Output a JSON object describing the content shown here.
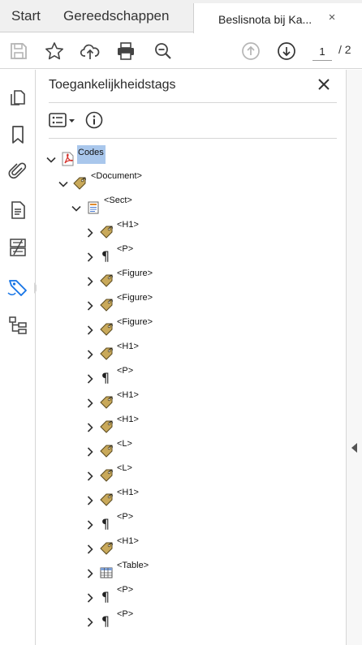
{
  "tabs": {
    "start": "Start",
    "tools": "Gereedschappen",
    "document": "Beslisnota bij Ka...",
    "close": "×"
  },
  "toolbar": {
    "icons": [
      "save-icon",
      "star-icon",
      "cloud-upload-icon",
      "print-icon",
      "zoom-out-icon",
      "page-up-icon",
      "page-down-icon"
    ],
    "page_current": "1",
    "page_total": "/ 2"
  },
  "rail": {
    "icons": [
      "pages-icon",
      "bookmark-icon",
      "attachment-icon",
      "document-icon",
      "compare-icon",
      "tags-icon",
      "content-tree-icon"
    ],
    "active": "tags-icon"
  },
  "panel": {
    "title": "Toegankelijkheidstags",
    "close": "×"
  },
  "tree": {
    "root": {
      "label": "Codes",
      "icon": "pdf-icon"
    },
    "document": {
      "label": "<Document>",
      "icon": "tag-icon"
    },
    "sect": {
      "label": "<Sect>",
      "icon": "section-icon"
    },
    "children": [
      {
        "label": "<H1>",
        "icon": "tag"
      },
      {
        "label": "<P>",
        "icon": "para"
      },
      {
        "label": "<Figure>",
        "icon": "tag"
      },
      {
        "label": "<Figure>",
        "icon": "tag"
      },
      {
        "label": "<Figure>",
        "icon": "tag"
      },
      {
        "label": "<H1>",
        "icon": "tag"
      },
      {
        "label": "<P>",
        "icon": "para"
      },
      {
        "label": "<H1>",
        "icon": "tag"
      },
      {
        "label": "<H1>",
        "icon": "tag"
      },
      {
        "label": "<L>",
        "icon": "tag"
      },
      {
        "label": "<L>",
        "icon": "tag"
      },
      {
        "label": "<H1>",
        "icon": "tag"
      },
      {
        "label": "<P>",
        "icon": "para"
      },
      {
        "label": "<H1>",
        "icon": "tag"
      },
      {
        "label": "<Table>",
        "icon": "table"
      },
      {
        "label": "<P>",
        "icon": "para"
      },
      {
        "label": "<P>",
        "icon": "para"
      }
    ]
  },
  "colors": {
    "accent": "#1473e6",
    "selection": "#a9c7ec",
    "tag_fill": "#c9a95a",
    "pdf_red": "#d6312b"
  }
}
